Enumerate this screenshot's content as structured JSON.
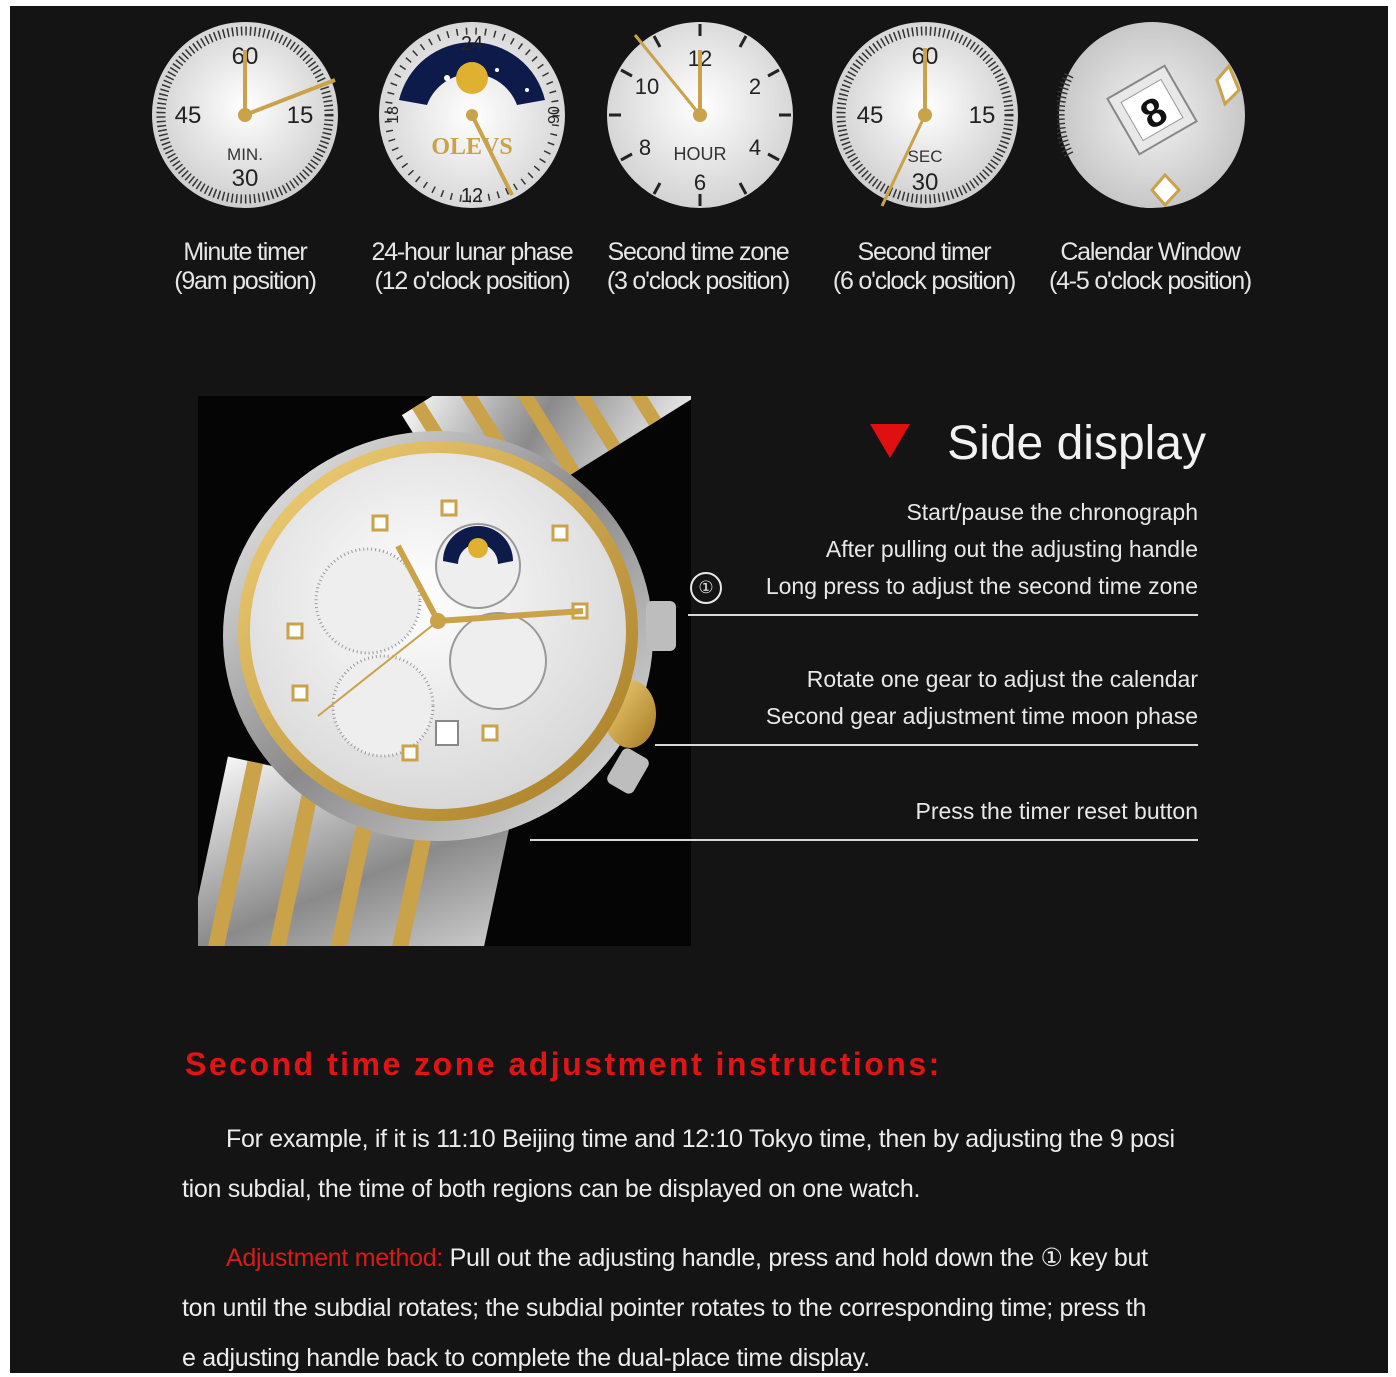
{
  "dials": [
    {
      "id": "minute",
      "numerals": [
        "60",
        "15",
        "30",
        "45"
      ],
      "label": "MIN."
    },
    {
      "id": "lunar",
      "numerals": [
        "24",
        "06",
        "12",
        "18"
      ],
      "brand": "OLEVS"
    },
    {
      "id": "hour",
      "numerals": [
        "12",
        "2",
        "4",
        "6",
        "8",
        "10"
      ],
      "label": "HOUR"
    },
    {
      "id": "second",
      "numerals": [
        "60",
        "15",
        "30",
        "45"
      ],
      "label": "SEC"
    },
    {
      "id": "calendar",
      "date": "8"
    }
  ],
  "captions": [
    {
      "line1": "Minute timer",
      "line2": "(9am position)"
    },
    {
      "line1": "24-hour lunar phase",
      "line2": "(12 o'clock position)"
    },
    {
      "line1": "Second time zone",
      "line2": "(3 o'clock position)"
    },
    {
      "line1": "Second timer",
      "line2": "(6 o'clock position)"
    },
    {
      "line1": "Calendar Window",
      "line2": "(4-5 o'clock position)"
    }
  ],
  "side": {
    "title": "Side display",
    "button1_marker": "①",
    "button1": [
      "Start/pause the chronograph",
      "After pulling out the adjusting handle",
      "Long press to adjust the second time zone"
    ],
    "crown": [
      "Rotate one gear to adjust the calendar",
      "Second gear adjustment time moon phase"
    ],
    "button2": [
      "Press the timer reset button"
    ]
  },
  "instructions": {
    "heading": "Second time zone adjustment instructions:",
    "para1": [
      "For example, if it is 11:10 Beijing time and 12:10 Tokyo time, then by adjusting the 9 posi",
      "tion subdial, the time of both regions can be displayed on one watch."
    ],
    "method_label": "Adjustment method:",
    "para2": [
      " Pull out the adjusting handle, press and hold down the ① key but",
      "ton until the subdial rotates; the subdial pointer rotates to the corresponding time; press th",
      "e adjusting handle back to complete the dual-place time display."
    ]
  },
  "colors": {
    "background": "#141414",
    "accent_red": "#e01010",
    "gold": "#c9a24a",
    "text": "#e8e8e8"
  }
}
